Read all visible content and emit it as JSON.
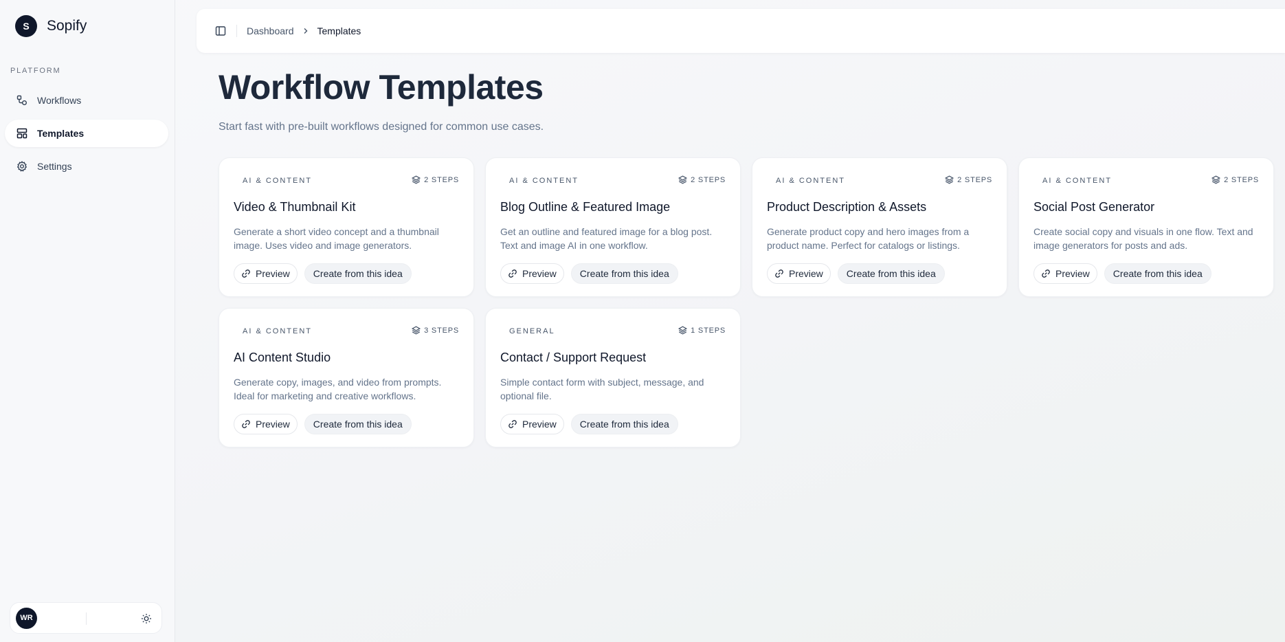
{
  "brand": {
    "logo_letter": "S",
    "name": "Sopify"
  },
  "sidebar": {
    "section_label": "PLATFORM",
    "items": [
      {
        "label": "Workflows",
        "icon": "workflow-icon",
        "active": false
      },
      {
        "label": "Templates",
        "icon": "layout-template-icon",
        "active": true
      },
      {
        "label": "Settings",
        "icon": "gear-icon",
        "active": false
      }
    ]
  },
  "user": {
    "initials": "WR"
  },
  "header": {
    "breadcrumb": [
      {
        "label": "Dashboard"
      },
      {
        "label": "Templates"
      }
    ]
  },
  "page": {
    "title": "Workflow Templates",
    "subtitle": "Start fast with pre-built workflows designed for common use cases."
  },
  "cards": [
    {
      "category": "AI & CONTENT",
      "steps": "2 STEPS",
      "title": "Video & Thumbnail Kit",
      "description": "Generate a short video concept and a thumbnail image. Uses video and image generators.",
      "preview_label": "Preview",
      "create_label": "Create from this idea"
    },
    {
      "category": "AI & CONTENT",
      "steps": "2 STEPS",
      "title": "Blog Outline & Featured Image",
      "description": "Get an outline and featured image for a blog post. Text and image AI in one workflow.",
      "preview_label": "Preview",
      "create_label": "Create from this idea"
    },
    {
      "category": "AI & CONTENT",
      "steps": "2 STEPS",
      "title": "Product Description & Assets",
      "description": "Generate product copy and hero images from a product name. Perfect for catalogs or listings.",
      "preview_label": "Preview",
      "create_label": "Create from this idea"
    },
    {
      "category": "AI & CONTENT",
      "steps": "2 STEPS",
      "title": "Social Post Generator",
      "description": "Create social copy and visuals in one flow. Text and image generators for posts and ads.",
      "preview_label": "Preview",
      "create_label": "Create from this idea"
    },
    {
      "category": "AI & CONTENT",
      "steps": "3 STEPS",
      "title": "AI Content Studio",
      "description": "Generate copy, images, and video from prompts. Ideal for marketing and creative workflows.",
      "preview_label": "Preview",
      "create_label": "Create from this idea"
    },
    {
      "category": "GENERAL",
      "steps": "1 STEPS",
      "title": "Contact / Support Request",
      "description": "Simple contact form with subject, message, and optional file.",
      "preview_label": "Preview",
      "create_label": "Create from this idea"
    }
  ],
  "colors": {
    "primary": "#0f172a",
    "muted_text": "#64748b",
    "card_bg": "#ffffff"
  }
}
